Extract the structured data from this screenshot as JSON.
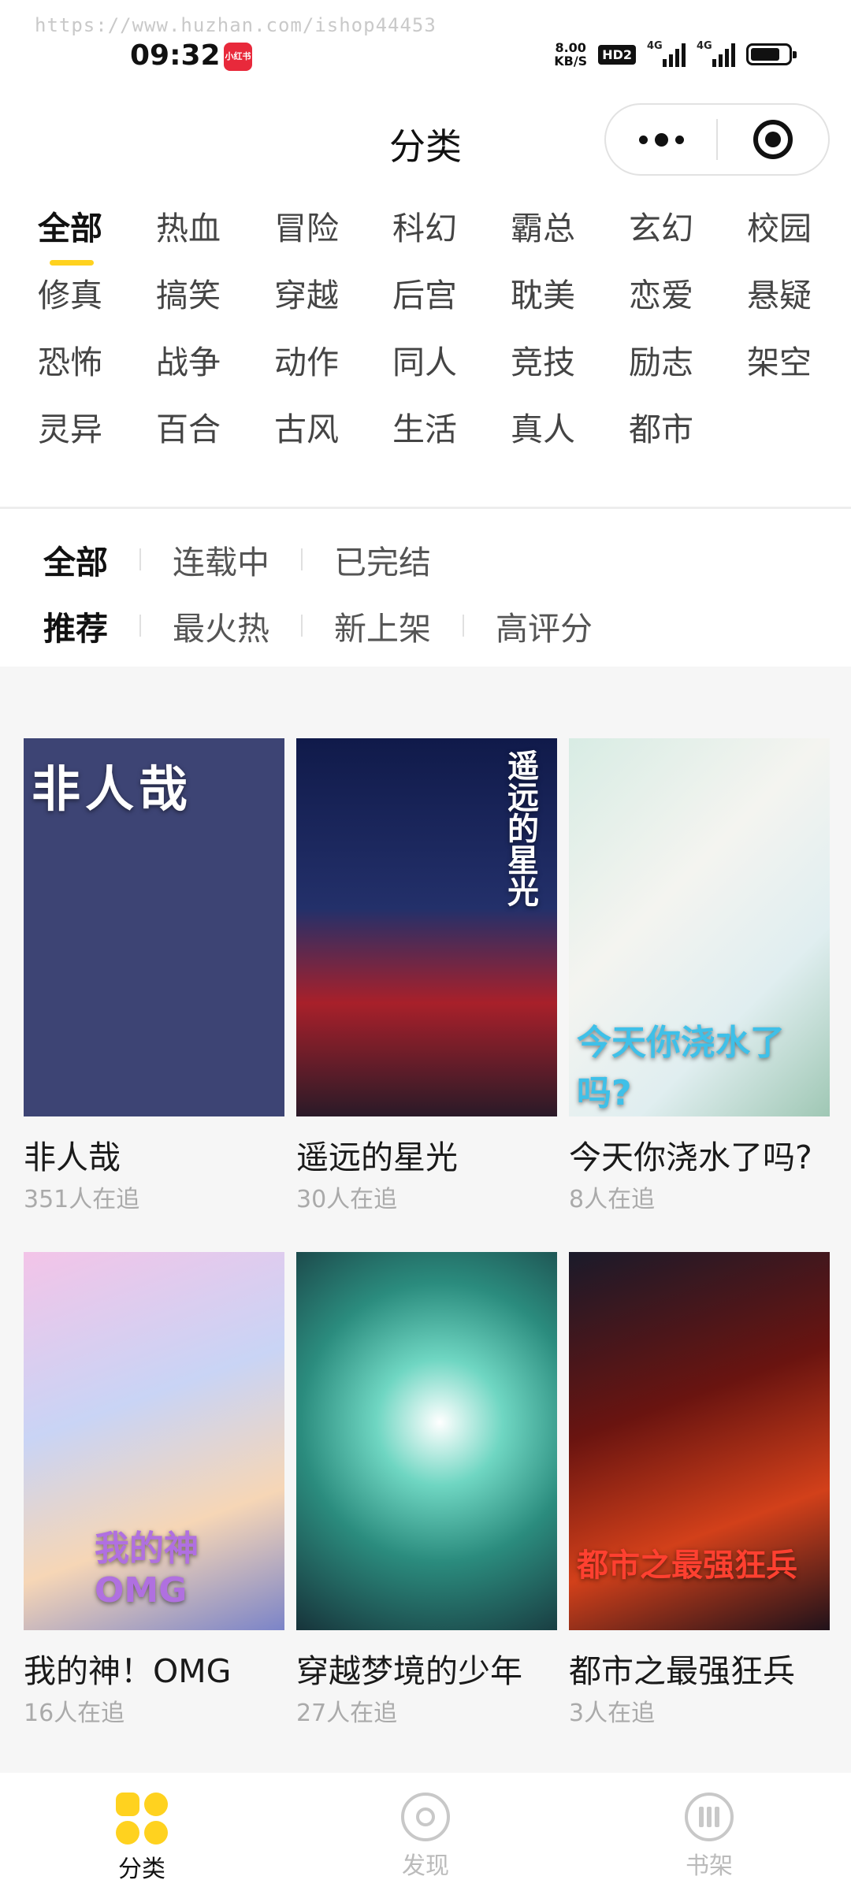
{
  "watermark": "https://www.huzhan.com/ishop44453",
  "status_bar": {
    "time": "09:32",
    "app_badge": "小红书",
    "net_speed_value": "8.00",
    "net_speed_unit": "KB/S",
    "hd_label": "HD2",
    "signal1_label": "4G",
    "signal2_label": "4G"
  },
  "header": {
    "title": "分类"
  },
  "genres": [
    "全部",
    "热血",
    "冒险",
    "科幻",
    "霸总",
    "玄幻",
    "校园",
    "修真",
    "搞笑",
    "穿越",
    "后宫",
    "耽美",
    "恋爱",
    "悬疑",
    "恐怖",
    "战争",
    "动作",
    "同人",
    "竞技",
    "励志",
    "架空",
    "灵异",
    "百合",
    "古风",
    "生活",
    "真人",
    "都市"
  ],
  "status_filters": [
    "全部",
    "连载中",
    "已完结"
  ],
  "sort_filters": [
    "推荐",
    "最火热",
    "新上架",
    "高评分"
  ],
  "comics": [
    {
      "cover_text": "非人哉",
      "title": "非人哉",
      "followers": "351人在追"
    },
    {
      "cover_text": "遥远的星光",
      "title": "遥远的星光",
      "followers": "30人在追"
    },
    {
      "cover_text": "今天你浇水了吗?",
      "title": "今天你浇水了吗?",
      "followers": "8人在追"
    },
    {
      "cover_text": "我的神OMG",
      "title": "我的神！OMG",
      "followers": "16人在追"
    },
    {
      "cover_text": "",
      "title": "穿越梦境的少年",
      "followers": "27人在追"
    },
    {
      "cover_text": "都市之最强狂兵",
      "title": "都市之最强狂兵",
      "followers": "3人在追"
    }
  ],
  "tabs": [
    "分类",
    "发现",
    "书架"
  ],
  "colors": {
    "accent": "#ffd21f",
    "content_bg": "#f6f6f6"
  }
}
